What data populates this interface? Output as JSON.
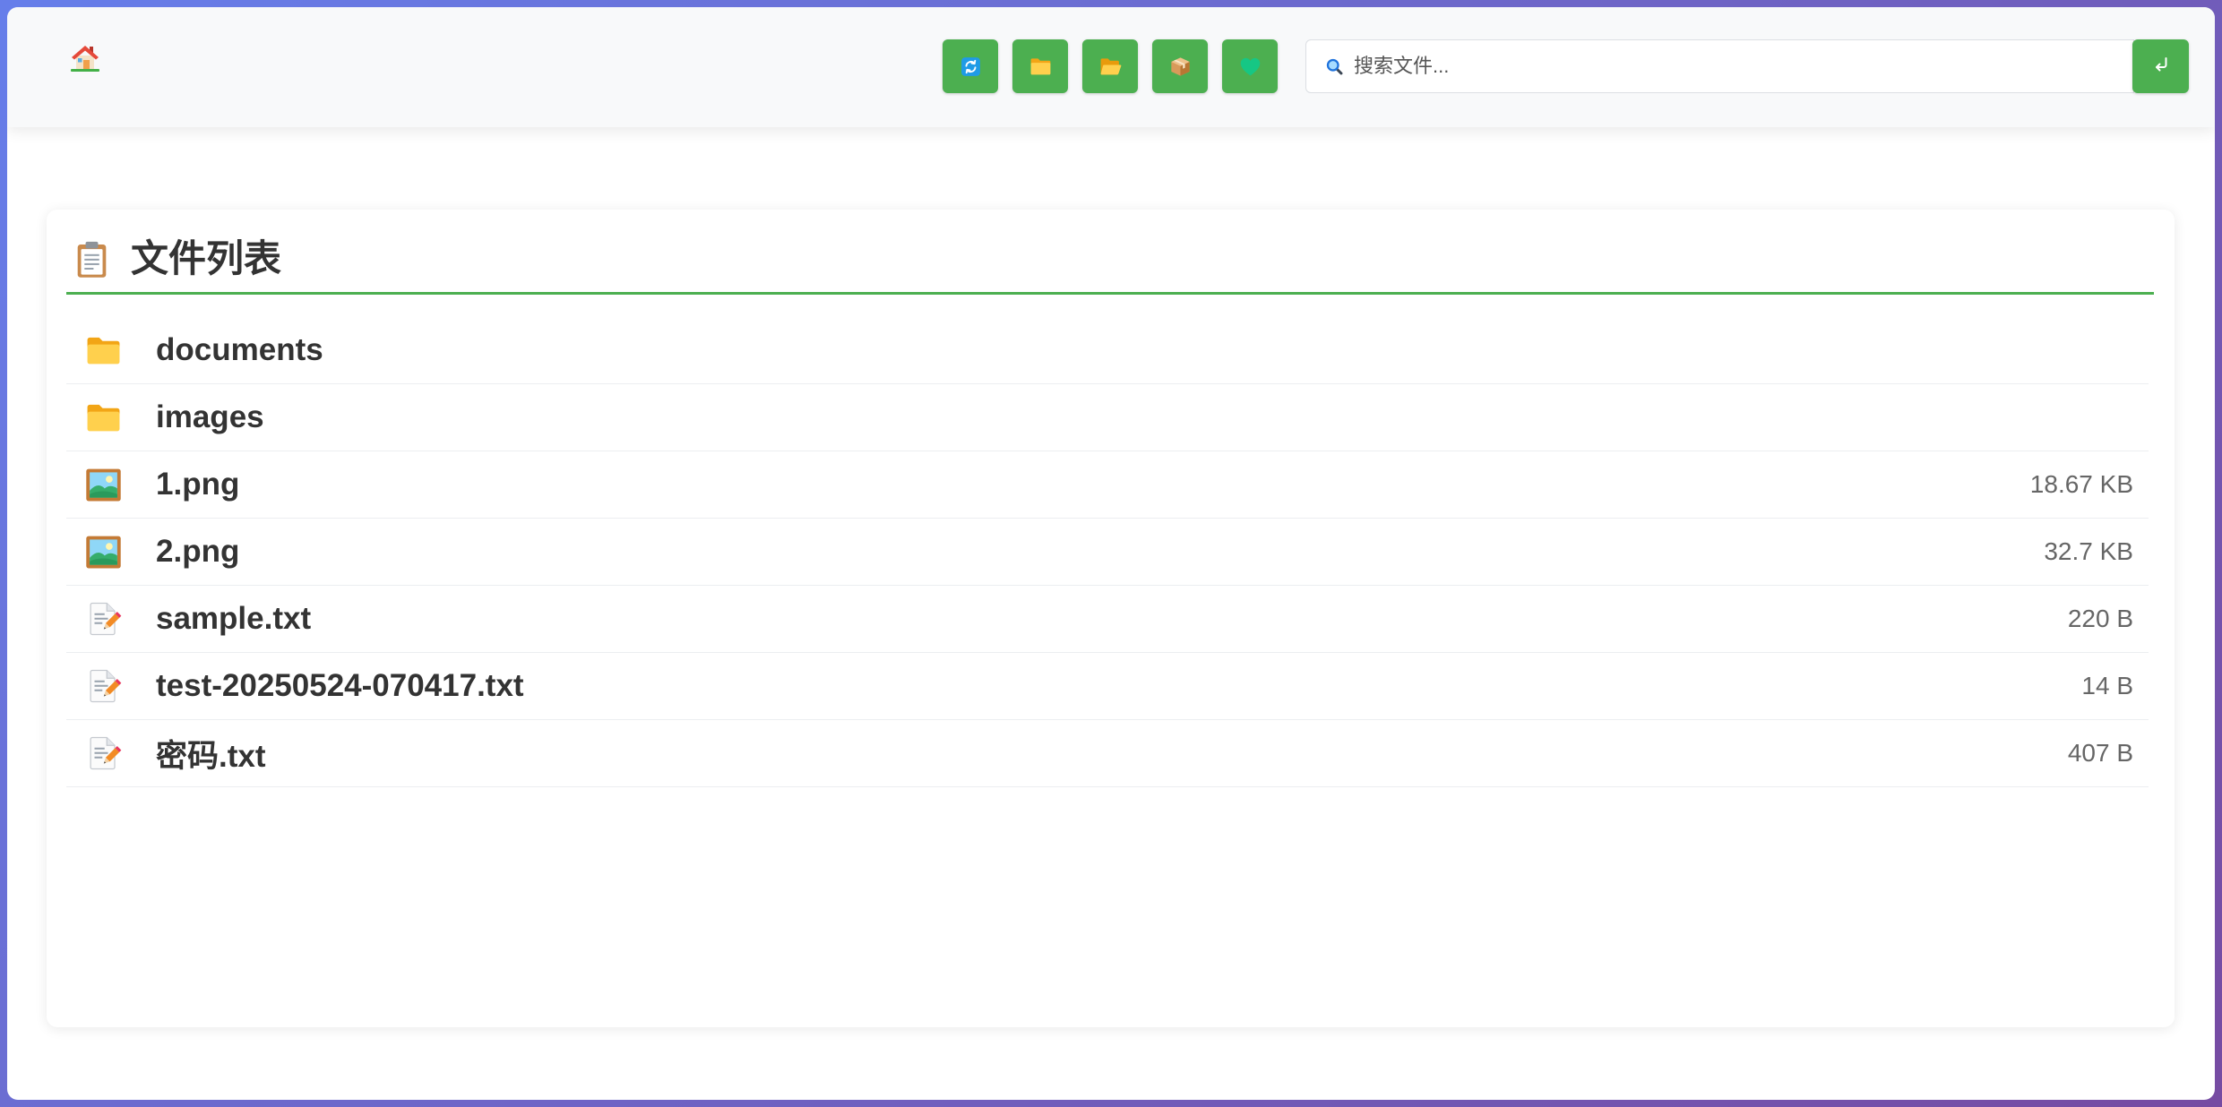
{
  "theme": {
    "accent": "#4CAF50",
    "background_gradient": [
      "#667eea",
      "#764ba2"
    ],
    "header_background": "#f8f9fa",
    "text_primary": "#333333",
    "text_secondary": "#666666"
  },
  "header": {
    "home": {
      "icon": "home-icon"
    },
    "toolbar": [
      {
        "icon": "refresh-icon"
      },
      {
        "icon": "folder-icon"
      },
      {
        "icon": "open-folder-icon"
      },
      {
        "icon": "package-icon"
      },
      {
        "icon": "green-heart-icon"
      }
    ],
    "search": {
      "icon": "search-icon",
      "placeholder": "搜索文件...",
      "value": "",
      "submit_icon": "enter-icon"
    }
  },
  "file_list": {
    "title_icon": "clipboard-icon",
    "title": "文件列表",
    "items": [
      {
        "icon": "folder-icon",
        "name": "documents"
      },
      {
        "icon": "folder-icon",
        "name": "images"
      },
      {
        "icon": "picture-icon",
        "name": "1.png",
        "size": "18.67 KB"
      },
      {
        "icon": "picture-icon",
        "name": "2.png",
        "size": "32.7 KB"
      },
      {
        "icon": "memo-icon",
        "name": "sample.txt",
        "size": "220 B"
      },
      {
        "icon": "memo-icon",
        "name": "test-20250524-070417.txt",
        "size": "14 B"
      },
      {
        "icon": "memo-icon",
        "name": "密码.txt",
        "size": "407 B"
      }
    ]
  }
}
